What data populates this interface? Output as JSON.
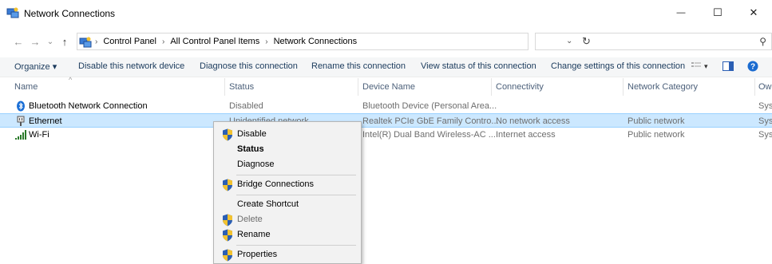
{
  "window": {
    "title": "Network Connections",
    "minimize_glyph": "—",
    "maximize_glyph": "☐",
    "close_glyph": "✕"
  },
  "navigation": {
    "back_glyph": "←",
    "forward_glyph": "→",
    "history_glyph": "⌄",
    "up_glyph": "↑",
    "breadcrumb": [
      "Control Panel",
      "All Control Panel Items",
      "Network Connections"
    ],
    "breadcrumb_separator": "›",
    "dropdown_glyph": "⌄",
    "refresh_glyph": "↻",
    "search_placeholder": "",
    "search_glyph": "⚲"
  },
  "toolbar": {
    "organize": "Organize ▾",
    "disable": "Disable this network device",
    "diagnose": "Diagnose this connection",
    "rename": "Rename this connection",
    "view_status": "View status of this connection",
    "change_settings": "Change settings of this connection",
    "view_options_glyph": "▾"
  },
  "columns": {
    "name": "Name",
    "status": "Status",
    "device_name": "Device Name",
    "connectivity": "Connectivity",
    "network_category": "Network Category",
    "owner": "Ow",
    "sort_glyph": "^"
  },
  "connections": [
    {
      "name": "Bluetooth Network Connection",
      "status": "Disabled",
      "device": "Bluetooth Device (Personal Area...",
      "connectivity": "",
      "category": "",
      "owner": "Sys",
      "icon": "bluetooth-icon"
    },
    {
      "name": "Ethernet",
      "status": "Unidentified network",
      "device": "Realtek PCIe GbE Family Contro...",
      "connectivity": "No network access",
      "category": "Public network",
      "owner": "Sys",
      "icon": "ethernet-icon"
    },
    {
      "name": "Wi-Fi",
      "status": "",
      "device": "Intel(R) Dual Band Wireless-AC ...",
      "connectivity": "Internet access",
      "category": "Public network",
      "owner": "Sys",
      "icon": "wifi-icon"
    }
  ],
  "context_menu": {
    "disable": "Disable",
    "status": "Status",
    "diagnose": "Diagnose",
    "bridge": "Bridge Connections",
    "create_shortcut": "Create Shortcut",
    "delete": "Delete",
    "rename": "Rename",
    "properties": "Properties"
  },
  "colors": {
    "selection": "#cce8ff",
    "shield_blue": "#2b5fb4",
    "shield_yellow": "#f2c230"
  }
}
